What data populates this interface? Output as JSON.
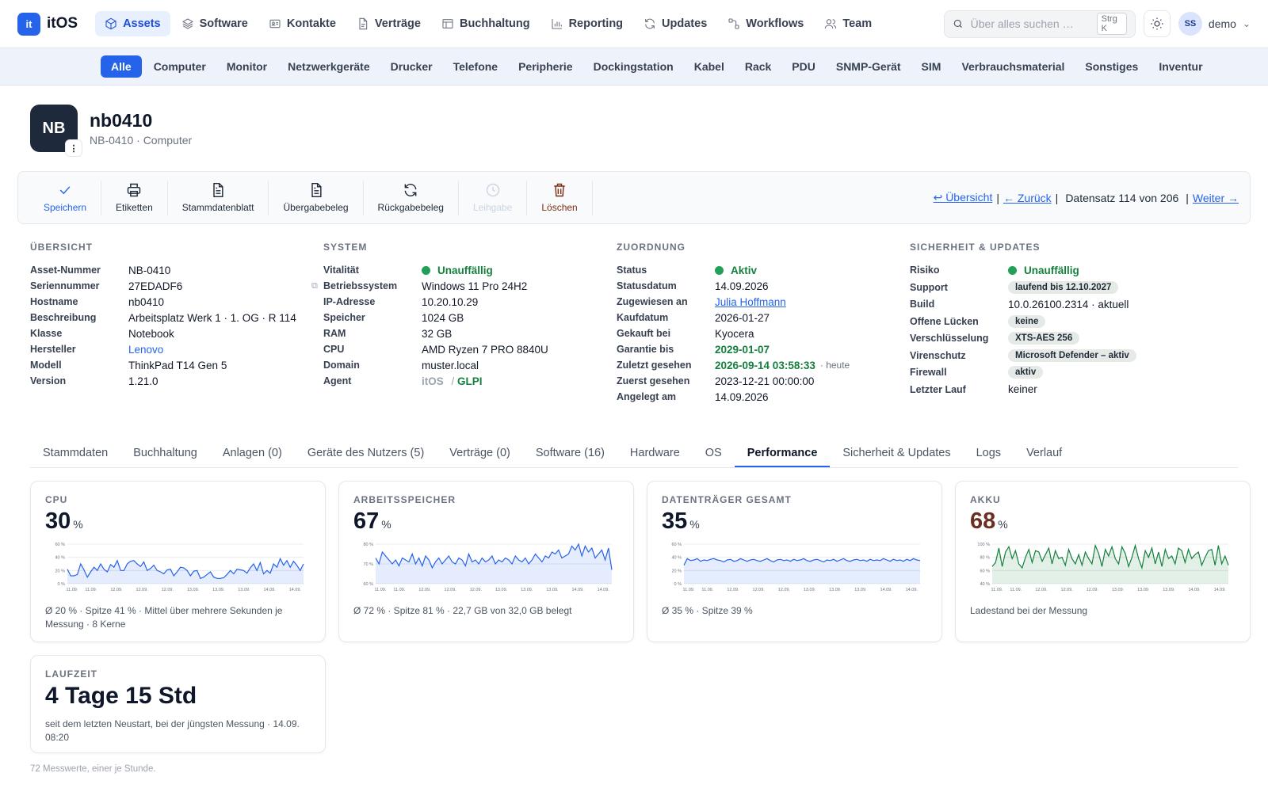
{
  "app": {
    "logo_mark": "it",
    "logo_name": "itOS"
  },
  "nav": [
    {
      "label": "Assets",
      "icon": "cube-icon",
      "active": true
    },
    {
      "label": "Software",
      "icon": "layers-icon"
    },
    {
      "label": "Kontakte",
      "icon": "contact-card-icon"
    },
    {
      "label": "Verträge",
      "icon": "document-icon"
    },
    {
      "label": "Buchhaltung",
      "icon": "table-icon"
    },
    {
      "label": "Reporting",
      "icon": "bar-chart-icon"
    },
    {
      "label": "Updates",
      "icon": "refresh-icon"
    },
    {
      "label": "Workflows",
      "icon": "workflow-icon"
    },
    {
      "label": "Team",
      "icon": "users-icon"
    }
  ],
  "search": {
    "placeholder": "Über alles suchen …",
    "shortcut": "Strg K"
  },
  "user": {
    "initials": "SS",
    "name": "demo"
  },
  "subnav": [
    "Alle",
    "Computer",
    "Monitor",
    "Netzwerkgeräte",
    "Drucker",
    "Telefone",
    "Peripherie",
    "Dockingstation",
    "Kabel",
    "Rack",
    "PDU",
    "SNMP-Gerät",
    "SIM",
    "Verbrauchsmaterial",
    "Sonstiges",
    "Inventur"
  ],
  "asset": {
    "badge": "NB",
    "title": "nb0410",
    "subtitle": "NB-0410 · Computer",
    "menu_icon": "⋮"
  },
  "toolbar": {
    "buttons": [
      {
        "label": "Speichern",
        "icon": "check-icon"
      },
      {
        "label": "Etiketten",
        "icon": "printer-icon"
      },
      {
        "label": "Stammdatenblatt",
        "icon": "document-icon"
      },
      {
        "label": "Übergabebeleg",
        "icon": "document-icon"
      },
      {
        "label": "Rückgabebeleg",
        "icon": "refresh-icon"
      },
      {
        "label": "Leihgabe",
        "icon": "clock-icon"
      },
      {
        "label": "Löschen",
        "icon": "trash-icon"
      }
    ],
    "overview": "↩ Übersicht",
    "back": "← Zurück",
    "record": "Datensatz 114 von 206",
    "next": "Weiter →"
  },
  "uebersicht": {
    "title": "ÜBERSICHT",
    "rows": [
      {
        "label": "Asset-Nummer",
        "value": "NB-0410"
      },
      {
        "label": "Seriennummer",
        "value": "27EDADF6"
      },
      {
        "label": "Hostname",
        "value": "nb0410"
      },
      {
        "label": "Beschreibung",
        "value": "Arbeitsplatz Werk 1 · 1. OG · R 114"
      },
      {
        "label": "Klasse",
        "value": "Notebook"
      },
      {
        "label": "Hersteller",
        "value": "Lenovo"
      },
      {
        "label": "Modell",
        "value": "ThinkPad T14 Gen 5"
      },
      {
        "label": "Version",
        "value": "1.21.0"
      }
    ],
    "copy_icon": "⧉"
  },
  "system": {
    "title": "SYSTEM",
    "rows": [
      {
        "label": "Vitalität",
        "value": "Unauffällig"
      },
      {
        "label": "Betriebssystem",
        "value": "Windows 11 Pro 24H2"
      },
      {
        "label": "IP-Adresse",
        "value": "10.20.10.29"
      },
      {
        "label": "Speicher",
        "value": "1024 GB"
      },
      {
        "label": "RAM",
        "value": "32 GB"
      },
      {
        "label": "CPU",
        "value": "AMD Ryzen 7 PRO 8840U"
      },
      {
        "label": "Domain",
        "value": "muster.local"
      },
      {
        "label": "Agent",
        "value": "itOS",
        "value2": "GLPI",
        "sep": " / "
      }
    ]
  },
  "zuordnung": {
    "title": "ZUORDNUNG",
    "rows": [
      {
        "label": "Status",
        "value": "Aktiv"
      },
      {
        "label": "Statusdatum",
        "value": "14.09.2026"
      },
      {
        "label": "Zugewiesen an",
        "value": "Julia Hoffmann"
      },
      {
        "label": "Kaufdatum",
        "value": "2026-01-27"
      },
      {
        "label": "Gekauft bei",
        "value": "Kyocera"
      },
      {
        "label": "Garantie bis",
        "value": "2029-01-07"
      },
      {
        "label": "Zuletzt gesehen",
        "value": "2026-09-14 03:58:33",
        "note": "· heute"
      },
      {
        "label": "Zuerst gesehen",
        "value": "2023-12-21 00:00:00"
      },
      {
        "label": "Angelegt am",
        "value": "14.09.2026"
      }
    ]
  },
  "sicherheit": {
    "title": "SICHERHEIT & UPDATES",
    "rows": [
      {
        "label": "Risiko",
        "value": "Unauffällig"
      },
      {
        "label": "Support",
        "value": "laufend bis 12.10.2027"
      },
      {
        "label": "Build",
        "value": "10.0.26100.2314 · aktuell"
      },
      {
        "label": "Offene Lücken",
        "value": "keine"
      },
      {
        "label": "Verschlüsselung",
        "value": "XTS-AES 256"
      },
      {
        "label": "Virenschutz",
        "value": "Microsoft Defender – aktiv"
      },
      {
        "label": "Firewall",
        "value": "aktiv"
      },
      {
        "label": "Letzter Lauf",
        "value": "keiner"
      }
    ]
  },
  "tabs": [
    "Stammdaten",
    "Buchhaltung",
    "Anlagen (0)",
    "Geräte des Nutzers (5)",
    "Verträge (0)",
    "Software (16)",
    "Hardware",
    "OS",
    "Performance",
    "Sicherheit & Updates",
    "Logs",
    "Verlauf"
  ],
  "active_tab": "Performance",
  "cards": {
    "cpu": {
      "title": "CPU",
      "value": "30",
      "unit": "%",
      "foot": "Ø 20 % · Spitze 41 % · Mittel über mehrere Sekunden je Messung · 8 Kerne"
    },
    "ram": {
      "title": "ARBEITSSPEICHER",
      "value": "67",
      "unit": "%",
      "foot": "Ø 72 % · Spitze 81 % · 22,7 GB von 32,0 GB belegt"
    },
    "disk": {
      "title": "DATENTRÄGER GESAMT",
      "value": "35",
      "unit": "%",
      "foot": "Ø 35 % · Spitze 39 %"
    },
    "battery": {
      "title": "AKKU",
      "value": "68",
      "unit": "%",
      "foot": "Ladestand bei der Messung"
    },
    "uptime": {
      "title": "LAUFZEIT",
      "value": "4 Tage 15 Std",
      "foot": "seit dem letzten Neustart, bei der jüngsten Messung · 14.09. 08:20"
    }
  },
  "footnote": "72 Messwerte, einer je Stunde.",
  "chart_data": [
    {
      "type": "area",
      "name": "CPU",
      "ylim": [
        0,
        60
      ],
      "yticks": [
        "0 %",
        "20 %",
        "40 %",
        "60 %"
      ],
      "xticks": [
        "11.09.",
        "11.09.",
        "12.09.",
        "12.09.",
        "12.09.",
        "13.09.",
        "13.09.",
        "13.09.",
        "14.09.",
        "14.09."
      ],
      "color": "#2563eb",
      "values": [
        22,
        12,
        12,
        14,
        30,
        21,
        10,
        18,
        25,
        20,
        30,
        22,
        18,
        29,
        25,
        35,
        20,
        20,
        30,
        34,
        35,
        30,
        26,
        33,
        20,
        23,
        28,
        20,
        18,
        15,
        21,
        22,
        12,
        18,
        25,
        24,
        20,
        12,
        19,
        20,
        8,
        10,
        14,
        18,
        10,
        8,
        8,
        9,
        14,
        20,
        15,
        22,
        21,
        20,
        16,
        24,
        30,
        20,
        32,
        15,
        20,
        16,
        30,
        25,
        38,
        28,
        35,
        25,
        34,
        28,
        20,
        30
      ]
    },
    {
      "type": "area",
      "name": "Arbeitsspeicher",
      "ylim": [
        60,
        80
      ],
      "yticks": [
        "60 %",
        "70 %",
        "80 %"
      ],
      "xticks": [
        "11.09.",
        "11.09.",
        "12.09.",
        "12.09.",
        "12.09.",
        "13.09.",
        "13.09.",
        "13.09.",
        "14.09.",
        "14.09."
      ],
      "color": "#2563eb",
      "values": [
        73,
        70,
        76,
        74,
        72,
        70,
        72,
        69,
        73,
        72,
        71,
        75,
        70,
        73,
        69,
        74,
        72,
        68,
        71,
        73,
        70,
        72,
        74,
        71,
        70,
        73,
        72,
        69,
        75,
        71,
        72,
        70,
        73,
        71,
        72,
        74,
        70,
        72,
        71,
        73,
        72,
        70,
        74,
        72,
        71,
        73,
        70,
        72,
        75,
        73,
        71,
        74,
        73,
        76,
        75,
        77,
        73,
        74,
        75,
        79,
        77,
        80,
        74,
        79,
        76,
        78,
        73,
        75,
        77,
        72,
        78,
        67
      ]
    },
    {
      "type": "area",
      "name": "Datenträger gesamt",
      "ylim": [
        0,
        60
      ],
      "yticks": [
        "0 %",
        "20 %",
        "40 %",
        "60 %"
      ],
      "xticks": [
        "11.09.",
        "11.09.",
        "12.09.",
        "12.09.",
        "12.09.",
        "13.09.",
        "13.09.",
        "13.09.",
        "14.09.",
        "14.09."
      ],
      "color": "#2563eb",
      "values": [
        28,
        38,
        35,
        36,
        38,
        34,
        36,
        35,
        37,
        38,
        36,
        35,
        33,
        36,
        37,
        34,
        35,
        38,
        36,
        34,
        36,
        37,
        35,
        34,
        36,
        38,
        35,
        33,
        36,
        37,
        35,
        36,
        34,
        37,
        35,
        36,
        38,
        35,
        34,
        36,
        37,
        35,
        33,
        36,
        35,
        37,
        34,
        36,
        38,
        35,
        34,
        36,
        37,
        35,
        36,
        34,
        37,
        35,
        36,
        35,
        38,
        36,
        34,
        37,
        35,
        36,
        34,
        37,
        35,
        38,
        36,
        35
      ]
    },
    {
      "type": "area",
      "name": "Akku",
      "ylim": [
        40,
        100
      ],
      "yticks": [
        "40 %",
        "60 %",
        "80 %",
        "100 %"
      ],
      "xticks": [
        "11.09.",
        "11.09.",
        "12.09.",
        "12.09.",
        "12.09.",
        "13.09.",
        "13.09.",
        "13.09.",
        "14.09.",
        "14.09."
      ],
      "color": "#15803d",
      "values": [
        66,
        72,
        94,
        66,
        88,
        96,
        78,
        90,
        70,
        64,
        80,
        92,
        72,
        90,
        88,
        74,
        84,
        94,
        70,
        90,
        78,
        80,
        68,
        92,
        78,
        70,
        84,
        68,
        88,
        78,
        70,
        98,
        86,
        66,
        92,
        82,
        96,
        78,
        70,
        96,
        86,
        66,
        80,
        98,
        78,
        64,
        90,
        80,
        94,
        70,
        88,
        66,
        92,
        78,
        82,
        70,
        94,
        90,
        72,
        92,
        78,
        84,
        88,
        68,
        80,
        90,
        92,
        68,
        98,
        70,
        82,
        68
      ]
    }
  ]
}
